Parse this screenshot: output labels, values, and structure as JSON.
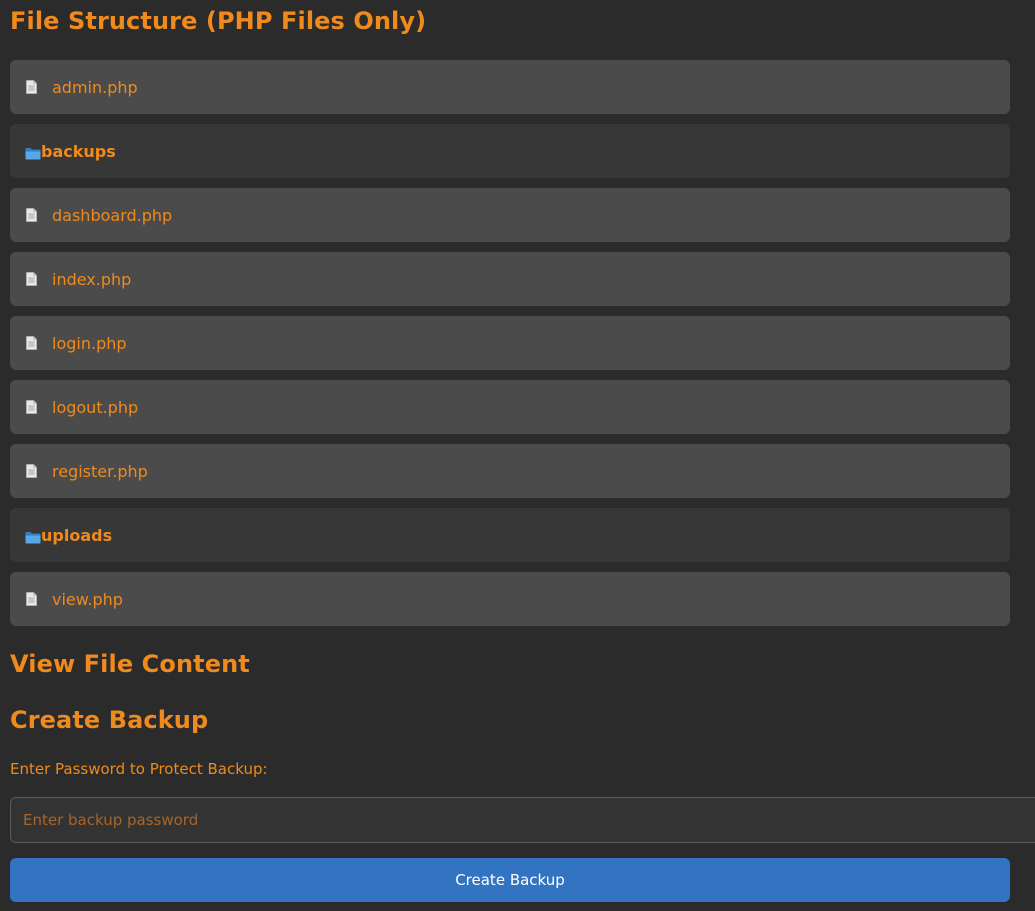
{
  "sections": {
    "files_title": "File Structure (PHP Files Only)",
    "view_title": "View File Content",
    "backup_title": "Create Backup"
  },
  "files": [
    {
      "name": "admin.php",
      "type": "file",
      "icon": "document-icon"
    },
    {
      "name": "backups",
      "type": "dir",
      "icon": "folder-icon"
    },
    {
      "name": "dashboard.php",
      "type": "file",
      "icon": "document-icon"
    },
    {
      "name": "index.php",
      "type": "file",
      "icon": "document-icon"
    },
    {
      "name": "login.php",
      "type": "file",
      "icon": "document-icon"
    },
    {
      "name": "logout.php",
      "type": "file",
      "icon": "document-icon"
    },
    {
      "name": "register.php",
      "type": "file",
      "icon": "document-icon"
    },
    {
      "name": "uploads",
      "type": "dir",
      "icon": "folder-icon"
    },
    {
      "name": "view.php",
      "type": "file",
      "icon": "document-icon"
    }
  ],
  "backup": {
    "password_label": "Enter Password to Protect Backup:",
    "password_placeholder": "Enter backup password",
    "password_value": "",
    "button_label": "Create Backup"
  },
  "colors": {
    "accent": "#f08a1c",
    "background": "#2b2b2b",
    "file_row": "#4b4b4b",
    "dir_row": "#373737",
    "button": "#3274c2"
  }
}
